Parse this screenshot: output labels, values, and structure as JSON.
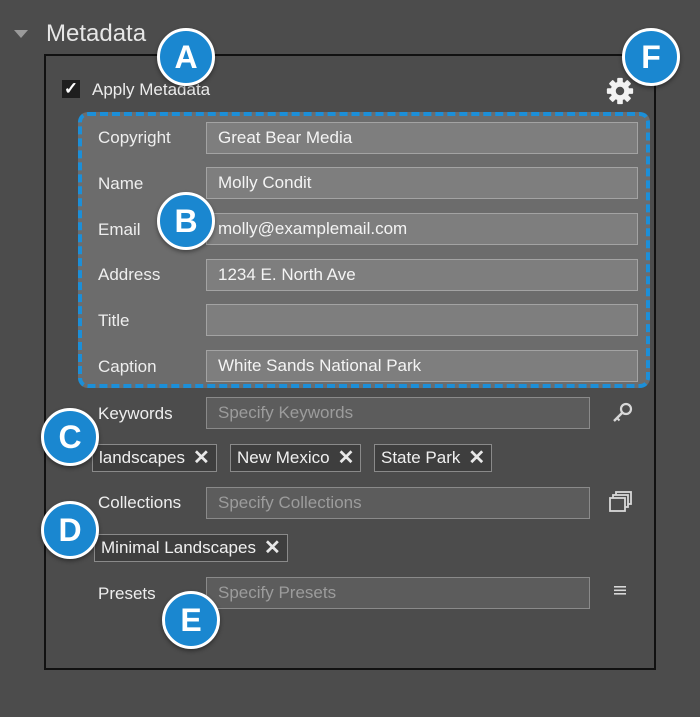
{
  "section": {
    "title": "Metadata"
  },
  "apply": {
    "checked_glyph": "✓",
    "label": "Apply Metadata"
  },
  "fields": [
    {
      "label": "Copyright",
      "value": "Great Bear Media"
    },
    {
      "label": "Name",
      "value": "Molly Condit"
    },
    {
      "label": "Email",
      "value": "molly@examplemail.com"
    },
    {
      "label": "Address",
      "value": "1234 E. North Ave"
    },
    {
      "label": "Title",
      "value": ""
    },
    {
      "label": "Caption",
      "value": "White Sands National Park"
    }
  ],
  "keywords": {
    "label": "Keywords",
    "placeholder": "Specify Keywords",
    "tags": [
      "landscapes",
      "New Mexico",
      "State Park"
    ],
    "icon": "key-icon"
  },
  "collections": {
    "label": "Collections",
    "placeholder": "Specify Collections",
    "tags": [
      "Minimal Landscapes"
    ],
    "icon": "stacked-windows-icon"
  },
  "presets": {
    "label": "Presets",
    "placeholder": "Specify Presets",
    "icon": "menu-lines-icon"
  },
  "tag_remove_glyph": "✕",
  "callouts": {
    "a": "A",
    "b": "B",
    "c": "C",
    "d": "D",
    "e": "E",
    "f": "F"
  },
  "colors": {
    "accent": "#1a87d0",
    "panel_bg": "#4c4c4c",
    "fields_bg": "#6c6c6c"
  }
}
